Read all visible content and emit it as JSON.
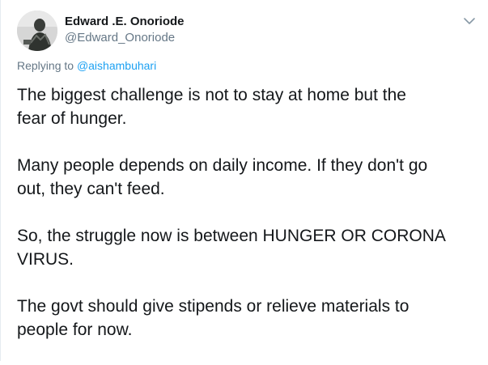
{
  "user": {
    "name": "Edward .E. Onoriode",
    "handle": "@Edward_Onoriode",
    "avatar_icon": "profile-photo"
  },
  "reply": {
    "prefix": "Replying to ",
    "to": "@aishambuhari"
  },
  "menu_icon": "chevron-down-icon",
  "tweet": {
    "paragraphs": [
      "The biggest challenge is not to stay at home but the\nfear of hunger.",
      "Many people depends on daily income. If they don't go\nout, they can't feed.",
      "So, the struggle now is between HUNGER OR CORONA\nVIRUS.",
      "The govt should give stipends or relieve materials to\npeople for now."
    ]
  },
  "colors": {
    "text": "#14171a",
    "secondary": "#657786",
    "link": "#1da1f2"
  }
}
